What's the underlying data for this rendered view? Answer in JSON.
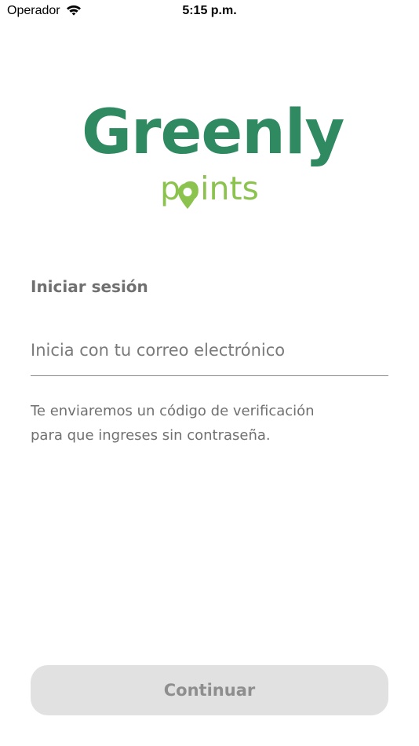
{
  "status_bar": {
    "carrier": "Operador",
    "time": "5:15 p.m."
  },
  "logo": {
    "main": "Greenly",
    "sub": "points",
    "main_color": "#2f8a61",
    "sub_color": "#8cc34f"
  },
  "login": {
    "title": "Iniciar sesión",
    "email_placeholder": "Inicia con tu correo electrónico",
    "email_value": "",
    "helper_line_1": "Te enviaremos un código de verificación",
    "helper_line_2": "para que ingreses sin contraseña."
  },
  "actions": {
    "continue_label": "Continuar"
  },
  "icons": {
    "wifi": "wifi-icon",
    "pin": "location-pin-icon"
  }
}
